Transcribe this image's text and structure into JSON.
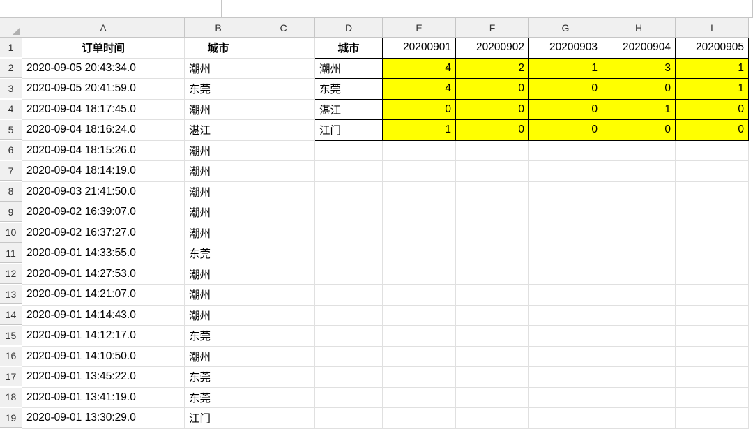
{
  "columns": [
    "A",
    "B",
    "C",
    "D",
    "E",
    "F",
    "G",
    "H",
    "I"
  ],
  "rowCount": 19,
  "headers": {
    "A1": "订单时间",
    "B1": "城市",
    "D1": "城市",
    "E1": "20200901",
    "F1": "20200902",
    "G1": "20200903",
    "H1": "20200904",
    "I1": "20200905"
  },
  "dataA": [
    "2020-09-05 20:43:34.0",
    "2020-09-05 20:41:59.0",
    "2020-09-04 18:17:45.0",
    "2020-09-04 18:16:24.0",
    "2020-09-04 18:15:26.0",
    "2020-09-04 18:14:19.0",
    "2020-09-03 21:41:50.0",
    "2020-09-02 16:39:07.0",
    "2020-09-02 16:37:27.0",
    "2020-09-01 14:33:55.0",
    "2020-09-01 14:27:53.0",
    "2020-09-01 14:21:07.0",
    "2020-09-01 14:14:43.0",
    "2020-09-01 14:12:17.0",
    "2020-09-01 14:10:50.0",
    "2020-09-01 13:45:22.0",
    "2020-09-01 13:41:19.0",
    "2020-09-01 13:30:29.0"
  ],
  "dataB": [
    "潮州",
    "东莞",
    "潮州",
    "湛江",
    "潮州",
    "潮州",
    "潮州",
    "潮州",
    "潮州",
    "东莞",
    "潮州",
    "潮州",
    "潮州",
    "东莞",
    "潮州",
    "东莞",
    "东莞",
    "江门"
  ],
  "pivot": {
    "rows": [
      "潮州",
      "东莞",
      "湛江",
      "江门"
    ],
    "values": [
      [
        4,
        2,
        1,
        3,
        1
      ],
      [
        4,
        0,
        0,
        0,
        1
      ],
      [
        0,
        0,
        0,
        1,
        0
      ],
      [
        1,
        0,
        0,
        0,
        0
      ]
    ]
  }
}
